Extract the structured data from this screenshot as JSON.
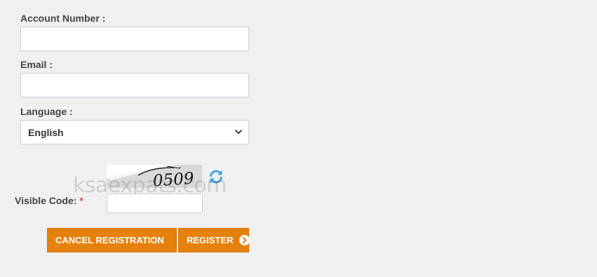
{
  "form": {
    "account_number": {
      "label": "Account Number :",
      "value": ""
    },
    "email": {
      "label": "Email :",
      "value": ""
    },
    "language": {
      "label": "Language :",
      "selected": "English"
    },
    "captcha": {
      "image_text": "0509",
      "label": "Visible Code:",
      "required_marker": "*",
      "value": ""
    },
    "watermark": "ksaexpats.com"
  },
  "buttons": {
    "cancel_label": "CANCEL REGISTRATION",
    "register_label": "REGISTER"
  },
  "colors": {
    "background": "#f0f0f0",
    "button": "#e5820d",
    "required": "#d9534f",
    "refresh_icon": "#3ea3dc"
  }
}
